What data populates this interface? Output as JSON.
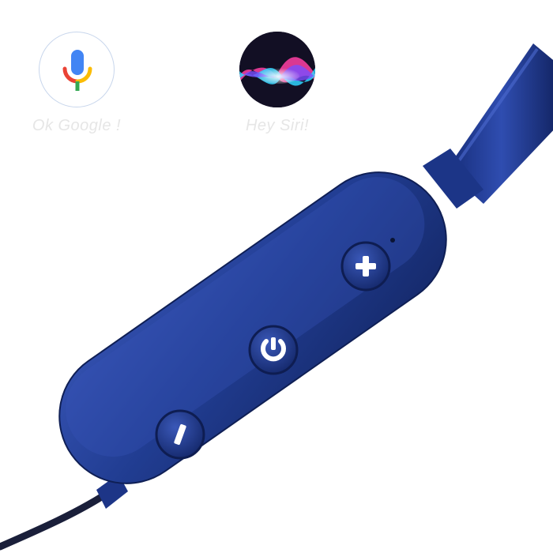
{
  "assistants": {
    "google": {
      "label": "Ok Google !",
      "icon": "google-mic-icon"
    },
    "siri": {
      "label": "Hey Siri!",
      "icon": "siri-wave-icon"
    }
  },
  "remote": {
    "buttons": [
      {
        "icon": "plus-icon",
        "role": "volume-up"
      },
      {
        "icon": "power-icon",
        "role": "power"
      },
      {
        "icon": "minus-icon",
        "role": "volume-down"
      }
    ]
  },
  "colors": {
    "remote_blue": "#1e3a8c",
    "google_blue": "#4285f4",
    "google_red": "#ea4335",
    "google_yellow": "#fbbc05",
    "google_green": "#34a853"
  }
}
